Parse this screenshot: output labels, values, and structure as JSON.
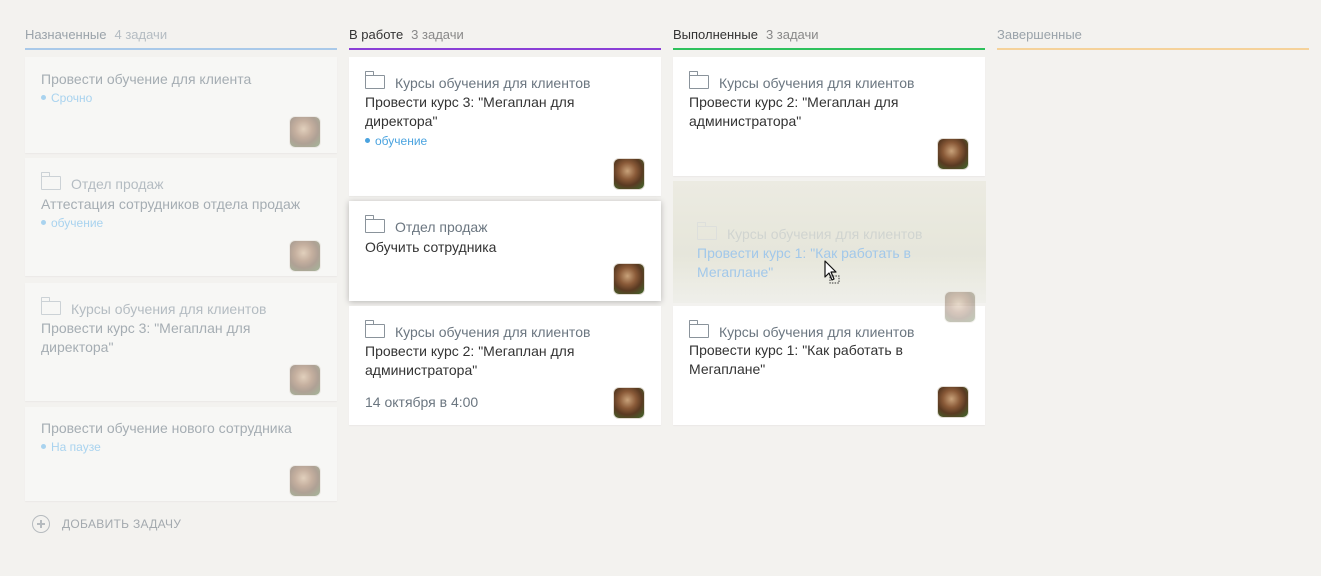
{
  "columns": [
    {
      "title": "Назначенные",
      "count": "4 задачи",
      "color": "#a9c9e9",
      "cards": [
        {
          "title": "Провести обучение для клиента",
          "tag": "Срочно"
        },
        {
          "project": "Отдел продаж",
          "title": "Аттестация сотрудников отдела продаж",
          "tag": "обучение"
        },
        {
          "project": "Курсы обучения для клиентов",
          "title": "Провести курс 3: \"Мегаплан для директора\""
        },
        {
          "title": "Провести обучение нового сотрудника",
          "tag": "На паузе"
        }
      ]
    },
    {
      "title": "В работе",
      "count": "3 задачи",
      "color": "#8a3fd6",
      "cards": [
        {
          "project": "Курсы обучения для клиентов",
          "title": "Провести курс 3: \"Мегаплан для директора\"",
          "tag": "обучение"
        },
        {
          "project": "Отдел продаж",
          "title": "Обучить сотрудника"
        },
        {
          "project": "Курсы обучения для клиентов",
          "title": "Провести курс 2: \"Мегаплан для администратора\"",
          "date": "14 октября в 4:00"
        }
      ]
    },
    {
      "title": "Выполненные",
      "count": "3 задачи",
      "color": "#2ec15c",
      "cards": [
        {
          "project": "Курсы обучения для клиентов",
          "title": "Провести курс 2: \"Мегаплан для администратора\""
        },
        {
          "project": "Курсы обучения для клиентов",
          "title": "Провести курс 1: \"Как работать в Мегаплане\""
        }
      ],
      "dragging_card": {
        "project": "Курсы обучения для клиентов",
        "title": "Провести курс 1: \"Как работать в Мегаплане\""
      }
    },
    {
      "title": "Завершенные",
      "count": "",
      "color": "#f5d29a",
      "cards": []
    }
  ],
  "add_task_label": "ДОБАВИТЬ ЗАДАЧУ",
  "icons": {
    "folder": "folder-icon",
    "avatar": "avatar",
    "add": "plus-circle-icon",
    "cursor": "move-cursor-icon"
  }
}
